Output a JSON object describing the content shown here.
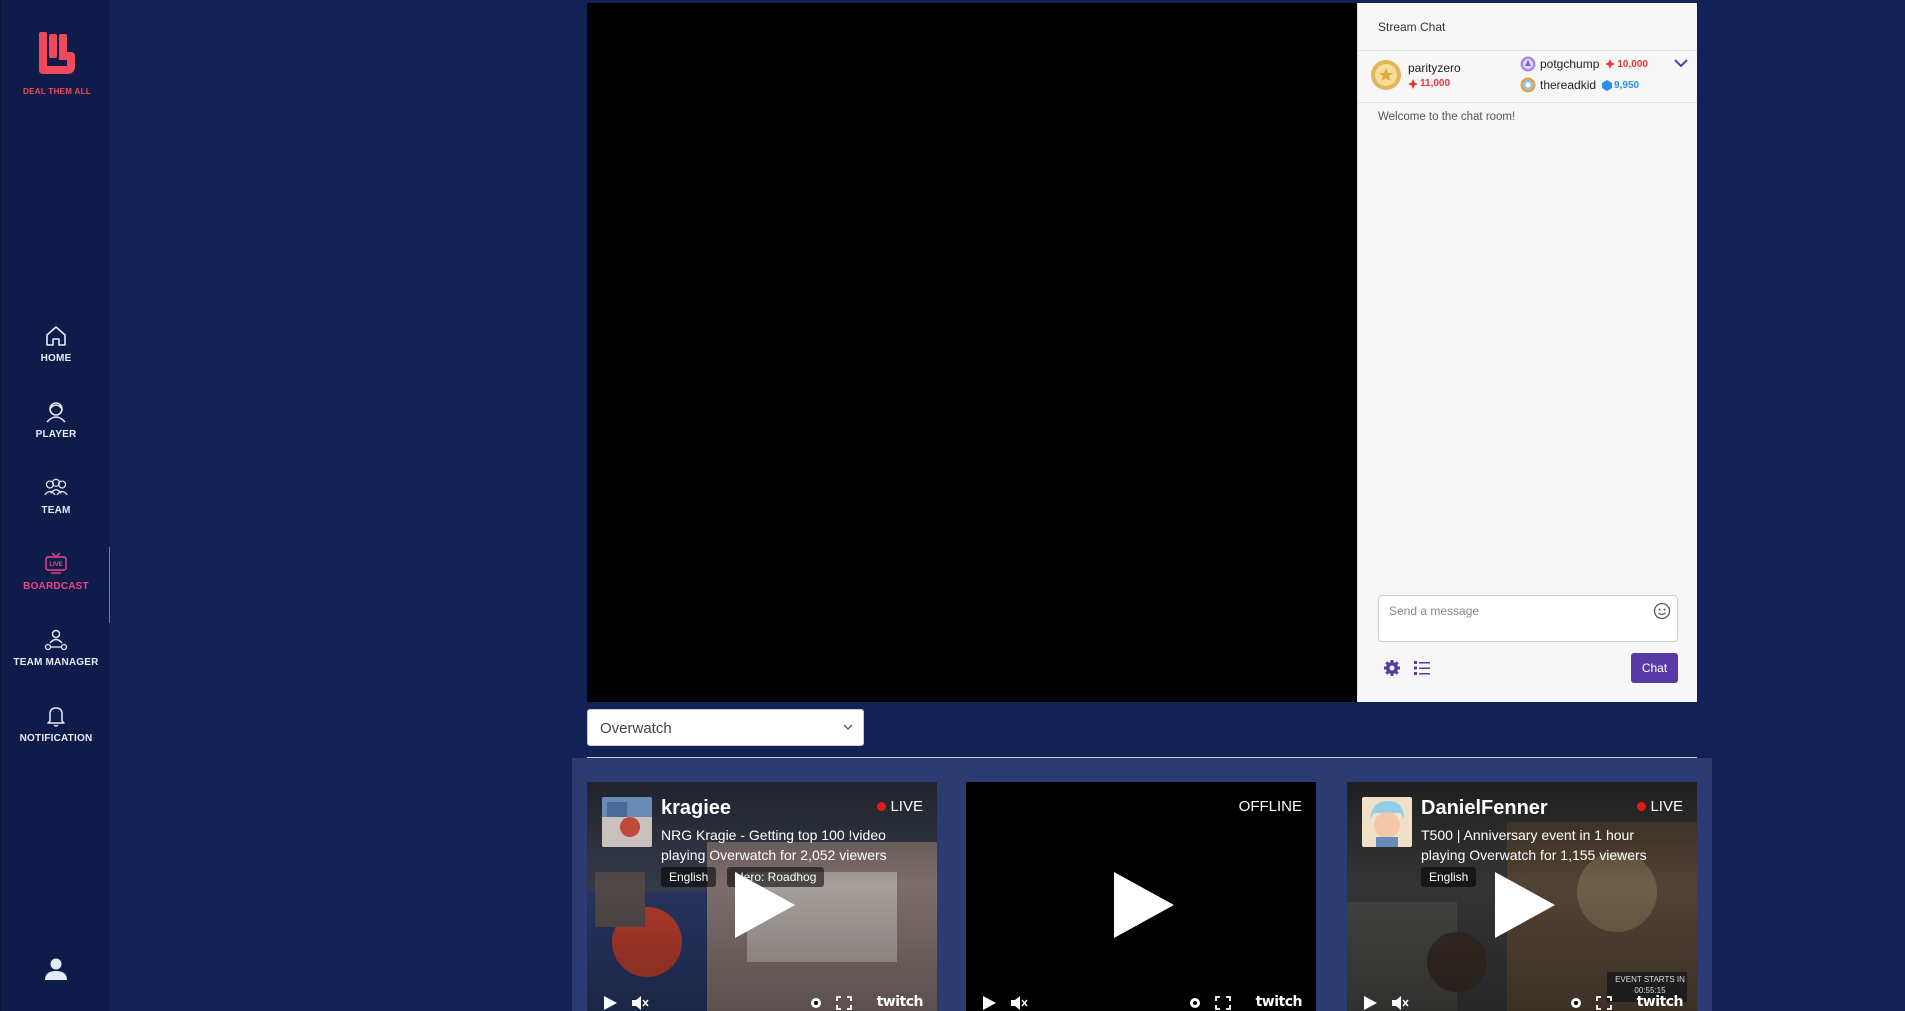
{
  "brand": {
    "name": "DEAL THEM ALL",
    "color": "#f04a5a"
  },
  "sidebar": {
    "items": [
      {
        "label": "HOME",
        "icon": "home-icon"
      },
      {
        "label": "PLAYER",
        "icon": "player-icon"
      },
      {
        "label": "TEAM",
        "icon": "team-icon"
      },
      {
        "label": "BOARDCAST",
        "icon": "live-broadcast-icon",
        "active": true
      },
      {
        "label": "TEAM MANAGER",
        "icon": "team-manager-icon"
      },
      {
        "label": "NOTIFICATION",
        "icon": "bell-icon"
      }
    ],
    "active_color": "#f0428a"
  },
  "chat": {
    "header": "Stream Chat",
    "leaderboard": [
      {
        "name": "parityzero",
        "score": "11,000",
        "badge": "gold"
      },
      {
        "name": "potgchump",
        "score": "10,000",
        "badge": "purple"
      },
      {
        "name": "thereadkid",
        "score": "9,950",
        "badge": "silver"
      }
    ],
    "welcome": "Welcome to the chat room!",
    "input_placeholder": "Send a message",
    "send_label": "Chat",
    "accent": "#5a3aa6"
  },
  "game_select": {
    "selected": "Overwatch"
  },
  "streams": [
    {
      "channel": "kragiee",
      "status": "LIVE",
      "title_line1": "NRG Kragie - Getting top 100 !video",
      "title_line2": "playing Overwatch for 2,052 viewers",
      "tags": [
        "English",
        "Hero: Roadhog"
      ]
    },
    {
      "channel": "",
      "status": "OFFLINE",
      "title_line1": "",
      "title_line2": "",
      "tags": []
    },
    {
      "channel": "DanielFenner",
      "status": "LIVE",
      "title_line1": "T500 | Anniversary event in 1 hour",
      "title_line2": "playing Overwatch for 1,155 viewers",
      "tags": [
        "English"
      ],
      "overlay_text": "EVENT STARTS IN 00:55:15"
    }
  ],
  "player_brand": "twitch"
}
